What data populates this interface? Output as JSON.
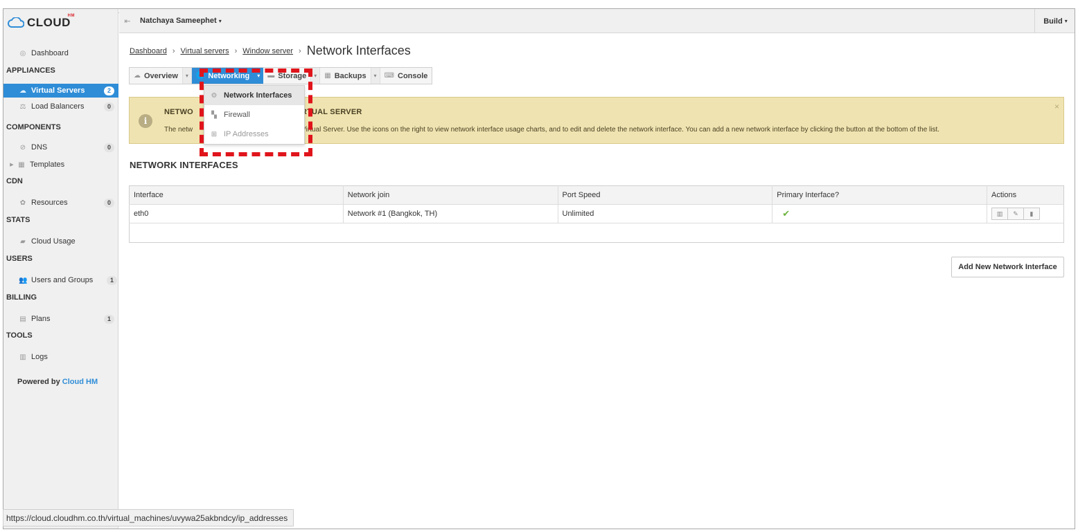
{
  "app": {
    "logo": "CLOUD",
    "logo_sup": "HM"
  },
  "topbar": {
    "user": "Natchaya Sameephet",
    "user_caret": "▾",
    "build": "Build",
    "build_caret": "▾"
  },
  "sidebar": {
    "dashboard": "Dashboard",
    "sections": {
      "appliances": "APPLIANCES",
      "components": "COMPONENTS",
      "cdn": "CDN",
      "stats": "STATS",
      "users": "USERS",
      "billing": "BILLING",
      "tools": "TOOLS"
    },
    "items": {
      "virtual_servers": {
        "label": "Virtual Servers",
        "count": "2"
      },
      "load_balancers": {
        "label": "Load Balancers",
        "count": "0"
      },
      "dns": {
        "label": "DNS",
        "count": "0"
      },
      "templates": {
        "label": "Templates"
      },
      "resources": {
        "label": "Resources",
        "count": "0"
      },
      "cloud_usage": {
        "label": "Cloud Usage"
      },
      "users_groups": {
        "label": "Users and Groups",
        "count": "1"
      },
      "plans": {
        "label": "Plans",
        "count": "1"
      },
      "logs": {
        "label": "Logs"
      }
    },
    "powered_prefix": "Powered by ",
    "powered_brand": "Cloud HM"
  },
  "breadcrumb": {
    "dashboard": "Dashboard",
    "virtual_servers": "Virtual servers",
    "window_server": "Window server",
    "current": "Network Interfaces",
    "sep": "›"
  },
  "tabs": {
    "overview": "Overview",
    "networking": "Networking",
    "storage": "Storage",
    "backups": "Backups",
    "console": "Console",
    "caret": "▾"
  },
  "dropdown": {
    "network_interfaces": "Network Interfaces",
    "firewall": "Firewall",
    "ip_addresses": "IP Addresses"
  },
  "alert": {
    "title_left": "NETWO",
    "title_right": "RTUAL SERVER",
    "text_left": "The netw",
    "text_right": "Virtual Server. Use the icons on the right to view network interface usage charts, and to edit and delete the network interface. You can add a new network interface by clicking the button at the bottom of the list.",
    "close": "×"
  },
  "section_title": "NETWORK INTERFACES",
  "table": {
    "headers": [
      "Interface",
      "Network join",
      "Port Speed",
      "Primary Interface?",
      "Actions"
    ],
    "rows": [
      {
        "interface": "eth0",
        "network_join": "Network #1 (Bangkok, TH)",
        "port_speed": "Unlimited",
        "primary": "✔"
      }
    ]
  },
  "add_button": "Add New Network Interface",
  "status_url": "https://cloud.cloudhm.co.th/virtual_machines/uvywa25akbndcy/ip_addresses",
  "colors": {
    "accent": "#2f8dd7",
    "alert_bg": "#efe4b1",
    "highlight": "#e0141b",
    "check": "#6cb33f"
  },
  "icons": {
    "dashboard": "dashboard-icon",
    "virtual_servers": "cloud-icon",
    "load_balancers": "balance-icon",
    "dns": "globe-icon",
    "templates": "template-icon",
    "resources": "resources-icon",
    "cloud_usage": "chart-icon",
    "users_groups": "users-icon",
    "plans": "plans-icon",
    "logs": "logs-icon"
  }
}
